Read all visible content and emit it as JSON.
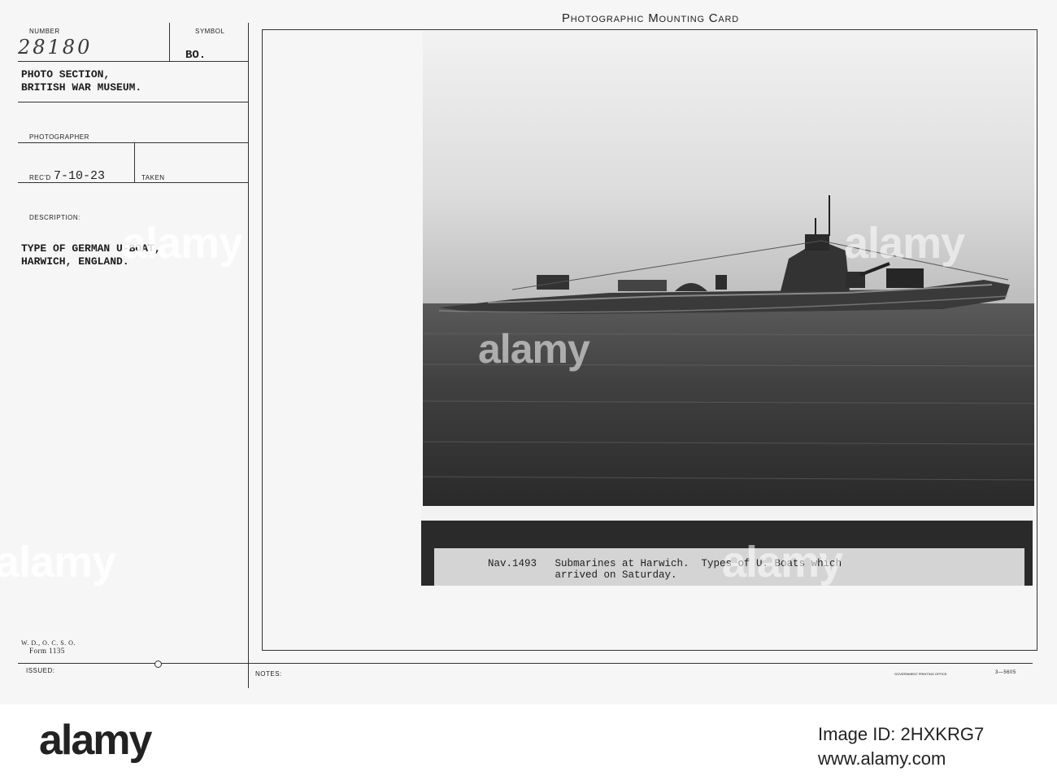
{
  "card": {
    "title": "Photographic Mounting Card",
    "number_label": "NUMBER",
    "number_value": "28180",
    "symbol_label": "SYMBOL",
    "symbol_value": "BO.",
    "source_line1": "PHOTO SECTION,",
    "source_line2": "BRITISH WAR MUSEUM.",
    "photographer_label": "PHOTOGRAPHER",
    "recd_label": "REC'D",
    "recd_value": "7-10-23",
    "taken_label": "TAKEN",
    "description_label": "DESCRIPTION:",
    "description_line1": "TYPE OF GERMAN U-BOAT,",
    "description_line2": "HARWICH, ENGLAND.",
    "form_line1": "W. D., O. C. S. O.",
    "form_line2": "Form 1135",
    "issued_label": "ISSUED:",
    "notes_label": "NOTES:",
    "printing_office": "GOVERNMENT PRINTING OFFICE",
    "printing_code": "3—5605"
  },
  "photo": {
    "caption_line1": "Nav.1493   Submarines at Harwich.  Types of U. Boats which",
    "caption_line2": "           arrived on Saturday."
  },
  "watermark": {
    "text": "alamy"
  },
  "footer": {
    "logo": "alamy",
    "image_id": "Image ID: 2HXKRG7",
    "url": "www.alamy.com"
  }
}
